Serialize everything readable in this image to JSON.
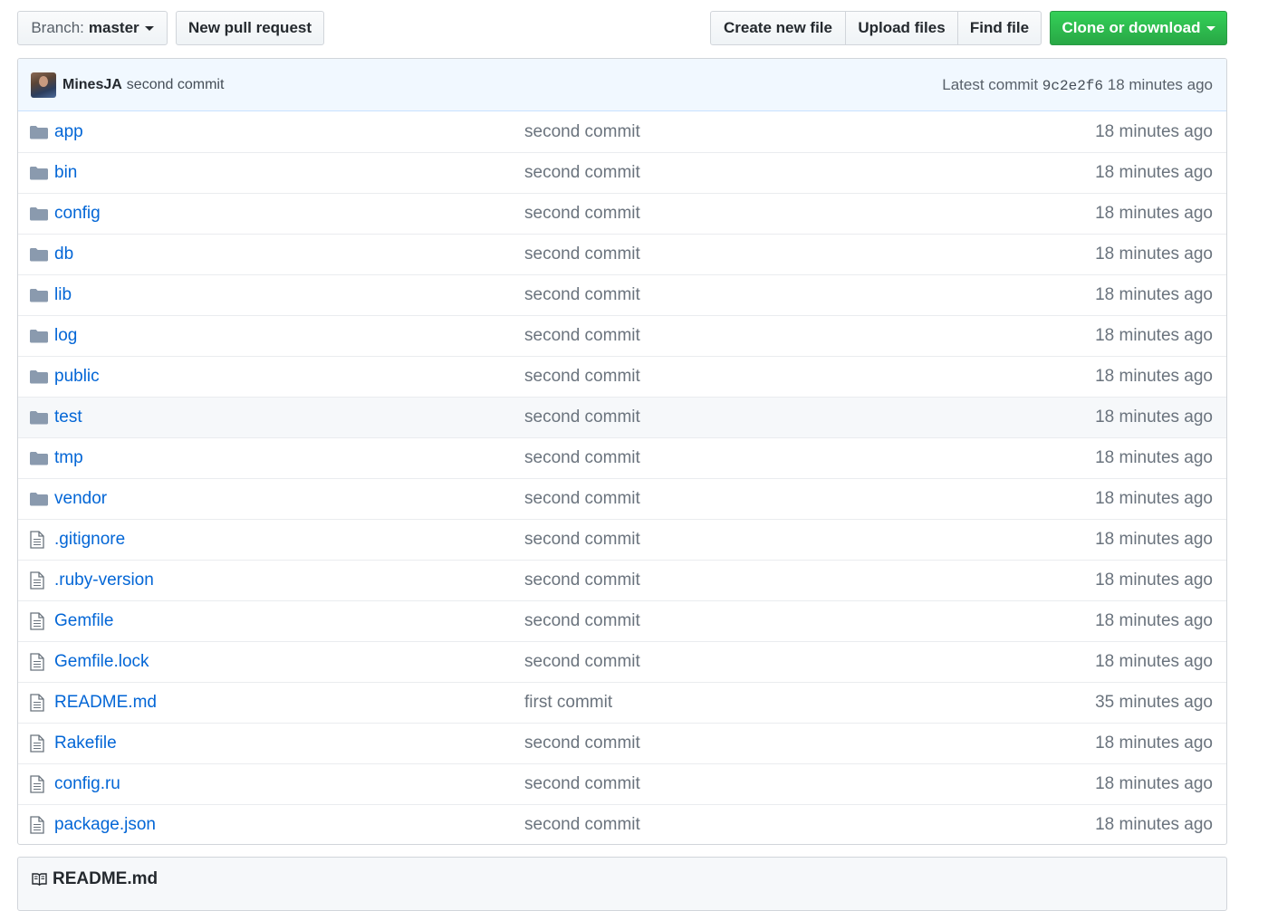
{
  "toolbar": {
    "branch_label": "Branch:",
    "branch_name": "master",
    "new_pr": "New pull request",
    "create_file": "Create new file",
    "upload_files": "Upload files",
    "find_file": "Find file",
    "clone": "Clone or download"
  },
  "commit": {
    "author": "MinesJA",
    "message": "second commit",
    "latest_label": "Latest commit",
    "sha": "9c2e2f6",
    "age": "18 minutes ago"
  },
  "files": [
    {
      "name": "app",
      "type": "dir",
      "message": "second commit",
      "age": "18 minutes ago"
    },
    {
      "name": "bin",
      "type": "dir",
      "message": "second commit",
      "age": "18 minutes ago"
    },
    {
      "name": "config",
      "type": "dir",
      "message": "second commit",
      "age": "18 minutes ago"
    },
    {
      "name": "db",
      "type": "dir",
      "message": "second commit",
      "age": "18 minutes ago"
    },
    {
      "name": "lib",
      "type": "dir",
      "message": "second commit",
      "age": "18 minutes ago"
    },
    {
      "name": "log",
      "type": "dir",
      "message": "second commit",
      "age": "18 minutes ago"
    },
    {
      "name": "public",
      "type": "dir",
      "message": "second commit",
      "age": "18 minutes ago"
    },
    {
      "name": "test",
      "type": "dir",
      "message": "second commit",
      "age": "18 minutes ago"
    },
    {
      "name": "tmp",
      "type": "dir",
      "message": "second commit",
      "age": "18 minutes ago"
    },
    {
      "name": "vendor",
      "type": "dir",
      "message": "second commit",
      "age": "18 minutes ago"
    },
    {
      "name": ".gitignore",
      "type": "file",
      "message": "second commit",
      "age": "18 minutes ago"
    },
    {
      "name": ".ruby-version",
      "type": "file",
      "message": "second commit",
      "age": "18 minutes ago"
    },
    {
      "name": "Gemfile",
      "type": "file",
      "message": "second commit",
      "age": "18 minutes ago"
    },
    {
      "name": "Gemfile.lock",
      "type": "file",
      "message": "second commit",
      "age": "18 minutes ago"
    },
    {
      "name": "README.md",
      "type": "file",
      "message": "first commit",
      "age": "35 minutes ago"
    },
    {
      "name": "Rakefile",
      "type": "file",
      "message": "second commit",
      "age": "18 minutes ago"
    },
    {
      "name": "config.ru",
      "type": "file",
      "message": "second commit",
      "age": "18 minutes ago"
    },
    {
      "name": "package.json",
      "type": "file",
      "message": "second commit",
      "age": "18 minutes ago"
    }
  ],
  "readme": {
    "title": "README.md"
  },
  "colors": {
    "link": "#0366d6",
    "muted": "#6a737d",
    "clone_green": "#28a745",
    "commit_bar": "#f1f8ff",
    "folder_icon": "#79b8ff"
  }
}
